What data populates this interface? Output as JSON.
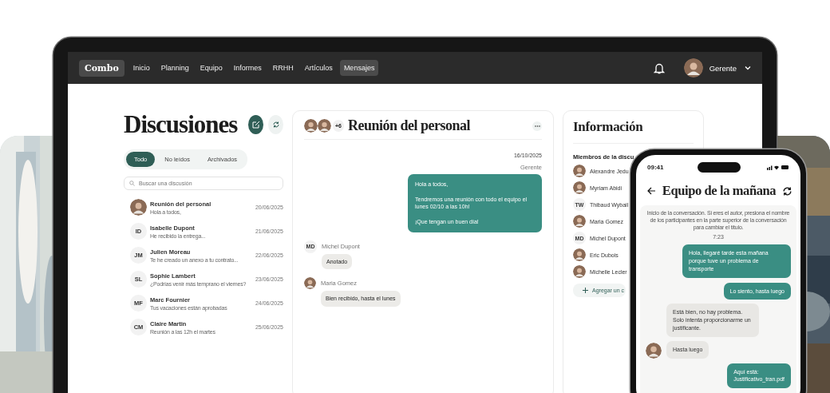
{
  "nav": {
    "logo": "Combo",
    "items": [
      {
        "label": "Inicio",
        "selected": false
      },
      {
        "label": "Planning",
        "selected": false
      },
      {
        "label": "Equipo",
        "selected": false
      },
      {
        "label": "Informes",
        "selected": false
      },
      {
        "label": "RRHH",
        "selected": false
      },
      {
        "label": "Artículos",
        "selected": false
      },
      {
        "label": "Mensajes",
        "selected": true
      }
    ],
    "user": "Gerente"
  },
  "discussions": {
    "title": "Discusiones",
    "filters": [
      {
        "label": "Todo",
        "selected": true
      },
      {
        "label": "No leídos",
        "selected": false
      },
      {
        "label": "Archivados",
        "selected": false
      }
    ],
    "search": {
      "placeholder": "Buscar una discusión"
    },
    "items": [
      {
        "name": "Reunión del personal",
        "preview": "Hola a todos,",
        "date": "20/06/2025"
      },
      {
        "kind": "initials",
        "initials": "ID",
        "name": "Isabelle Dupont",
        "preview": "He recibido la entrega...",
        "date": "21/06/2025"
      },
      {
        "kind": "initials",
        "initials": "JM",
        "name": "Julien Moreau",
        "preview": "Te he creado un anexo a tu contrato...",
        "date": "22/06/2025"
      },
      {
        "kind": "initials",
        "initials": "SL",
        "name": "Sophie Lambert",
        "preview": "¿Podrías venir más temprano el viernes?",
        "date": "23/06/2025"
      },
      {
        "kind": "initials",
        "initials": "MF",
        "name": "Marc Fournier",
        "preview": "Tus vacaciones están aprobadas",
        "date": "24/06/2025"
      },
      {
        "kind": "initials",
        "initials": "CM",
        "name": "Claire Martin",
        "preview": "Reunión a las 12h el martes",
        "date": "25/06/2025"
      }
    ]
  },
  "conversation": {
    "title": "Reunión del personal",
    "extra_count": "+6",
    "date": "16/10/2025",
    "messages": [
      {
        "kind": "sent",
        "author": "Gerente",
        "text": "Hola a todos,\n\nTendremos una reunión con todo el equipo el lunes 02/10 a las 10h!\n\n¡Que tengan un buen día!"
      },
      {
        "kind": "received",
        "initials": "MD",
        "author": "Michel Dupont",
        "text": "Anotado"
      },
      {
        "kind": "received",
        "author": "Maria Gomez",
        "text": "Bien recibido, hasta el lunes"
      }
    ]
  },
  "info": {
    "title": "Información",
    "members_heading": "Miembros de la discu",
    "members": [
      {
        "name": "Alexandre Jedu"
      },
      {
        "name": "Myriam Abidi"
      },
      {
        "kind": "initials",
        "initials": "TW",
        "name": "Thibaud Wybail"
      },
      {
        "name": "Maria Gomez"
      },
      {
        "kind": "initials",
        "initials": "MD",
        "name": "Michel Dupont"
      },
      {
        "name": "Eric Dubois"
      },
      {
        "name": "Michelle Lecler"
      }
    ],
    "add_button": "Agregar un c"
  },
  "phone": {
    "time": "09:41",
    "title": "Equipo de la mañana",
    "intro": "Inicio de la conversación. Si eres el autor, presiona el nombre de los participantes en la parte superior de la conversación para cambiar el título.",
    "timestamp": "7:23",
    "messages": [
      {
        "kind": "sent",
        "text": "Hola, llegaré tarde esta mañana porque tuve un problema de transporte"
      },
      {
        "kind": "sent",
        "text": "Lo siento, hasta luego"
      },
      {
        "kind": "received",
        "text": "Está bien, no hay problema. Solo intenta proporcionarme un justificante.",
        "avatar": false
      },
      {
        "kind": "received",
        "text": "Hasta luego",
        "avatar": true
      },
      {
        "kind": "sent",
        "text": "Aquí está:\nJustificativo_tran.pdf"
      }
    ]
  }
}
